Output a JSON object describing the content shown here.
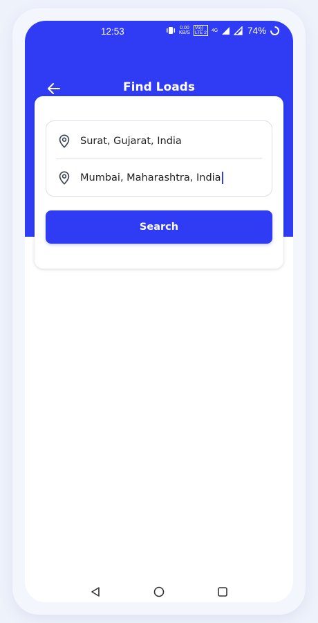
{
  "status_bar": {
    "time": "12:53",
    "net_speed_value": "0.00",
    "net_speed_unit": "KB/S",
    "volte_top": "Vo))",
    "volte_bottom": "LTE 2",
    "network_type": "4G",
    "battery_percent": "74%"
  },
  "header": {
    "title": "Find Loads"
  },
  "search_form": {
    "from_location": "Surat, Gujarat, India",
    "to_location": "Mumbai, Maharashtra, India",
    "search_label": "Search"
  },
  "colors": {
    "primary": "#2f3cf3",
    "background": "#eef2fb",
    "card": "#ffffff",
    "text": "#222222"
  }
}
